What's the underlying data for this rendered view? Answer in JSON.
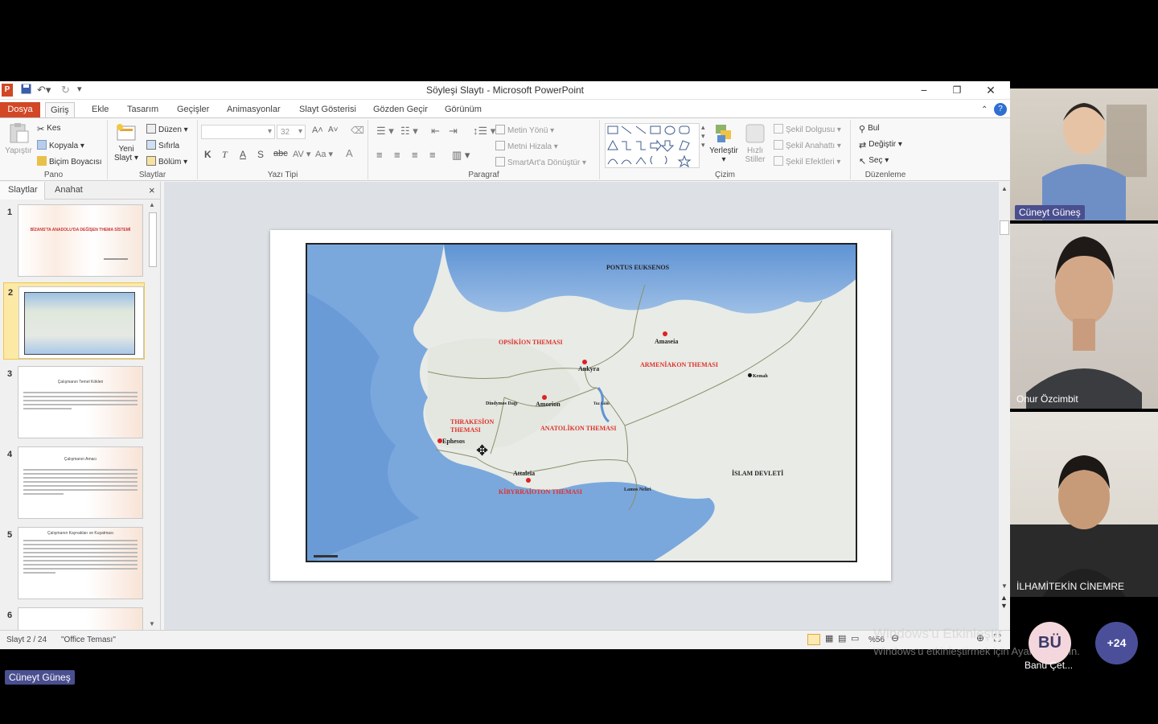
{
  "window": {
    "title": "Söyleşi Slaytı  -  Microsoft PowerPoint",
    "file_tab": "Dosya",
    "tabs": [
      "Giriş",
      "Ekle",
      "Tasarım",
      "Geçişler",
      "Animasyonlar",
      "Slayt Gösterisi",
      "Gözden Geçir",
      "Görünüm"
    ],
    "active_tab": "Giriş"
  },
  "ribbon": {
    "pano": {
      "label": "Pano",
      "paste": "Yapıştır",
      "cut": "Kes",
      "copy": "Kopyala",
      "format_painter": "Biçim Boyacısı"
    },
    "slaytlar": {
      "label": "Slaytlar",
      "new_slide_1": "Yeni",
      "new_slide_2": "Slayt",
      "layout": "Düzen",
      "reset": "Sıfırla",
      "section": "Bölüm"
    },
    "yazi_tipi": {
      "label": "Yazı Tipi",
      "font_size": "32"
    },
    "paragraf": {
      "label": "Paragraf",
      "text_direction": "Metin Yönü",
      "align_text": "Metni Hizala",
      "smartart": "SmartArt'a Dönüştür"
    },
    "cizim": {
      "label": "Çizim",
      "arrange": "Yerleştir",
      "quick_styles_1": "Hızlı",
      "quick_styles_2": "Stiller",
      "shape_fill": "Şekil Dolgusu",
      "shape_outline": "Şekil Anahattı",
      "shape_effects": "Şekil Efektleri"
    },
    "duzenleme": {
      "label": "Düzenleme",
      "find": "Bul",
      "replace": "Değiştir",
      "select": "Seç"
    }
  },
  "slides_pane": {
    "tab_slides": "Slaytlar",
    "tab_outline": "Anahat",
    "thumbnails": [
      {
        "num": "1",
        "title": "BİZANS'TA ANADOLU'DA DEĞİŞEN THEMA SİSTEMİ"
      },
      {
        "num": "2",
        "title": ""
      },
      {
        "num": "3",
        "title": "Çalışmanın Temel Kökleri"
      },
      {
        "num": "4",
        "title": "Çalışmanın Amacı"
      },
      {
        "num": "5",
        "title": "Çalışmanın Kaynakları ve Kuşatması"
      },
      {
        "num": "6",
        "title": ""
      }
    ],
    "selected": "2"
  },
  "map": {
    "labels": {
      "pontus": "PONTUS EUKSENOS",
      "opsikion": "OPSİKİON THEMASI",
      "amaseia": "Amaseia",
      "armeniakon": "ARMENİAKON THEMASI",
      "ankyra": "Ankyra",
      "kemah": "Kemah",
      "dindymos": "Dindymos Dağı",
      "amorion": "Amorion",
      "thrakesion": "THRAKESİON THEMASI",
      "anatolikon": "ANATOLİKON THEMASI",
      "ephesos": "Ephesos",
      "attaleia": "Attaleia",
      "kibyrrhaioton": "KİBYRRAİOTON THEMASI",
      "lamos": "Lamos Nehri",
      "islam": "İSLAM DEVLETİ",
      "tuz": "Tuz Gölü"
    }
  },
  "status": {
    "slide_info": "Slayt 2 / 24",
    "theme": "\"Office Teması\"",
    "zoom": "%56"
  },
  "watermark": {
    "line1": "Windows'u Etkinleştir",
    "line2": "Windows'u etkinleştirmek için Ayarlar'a gidin."
  },
  "participants": {
    "p1": "Cüneyt Güneş",
    "p2": "Onur Özcimbit",
    "p3": "İLHAMİTEKİN CİNEMRE",
    "initials": "BÜ",
    "initials_name": "Banu Çet...",
    "more": "+24",
    "presenter": "Cüneyt Güneş"
  },
  "colors": {
    "file_tab": "#d24726",
    "name_tag": "#4a4f8f",
    "bubble_pink": "#f4d7dc",
    "bubble_more": "#4b4f9a",
    "thema_red": "#e0302a"
  }
}
